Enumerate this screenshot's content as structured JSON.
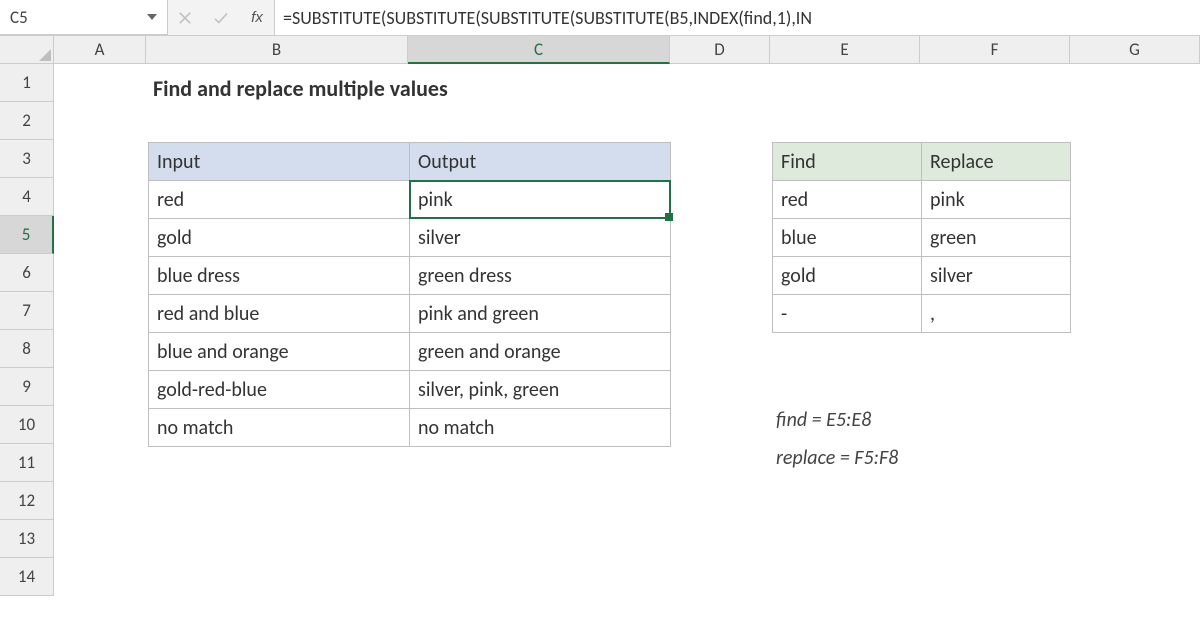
{
  "nameBox": "C5",
  "formula": "=SUBSTITUTE(SUBSTITUTE(SUBSTITUTE(SUBSTITUTE(B5,INDEX(find,1),IN",
  "columns": [
    "A",
    "B",
    "C",
    "D",
    "E",
    "F",
    "G"
  ],
  "rows": [
    "1",
    "2",
    "3",
    "4",
    "5",
    "6",
    "7",
    "8",
    "9",
    "10",
    "11",
    "12",
    "13",
    "14"
  ],
  "selectedCol": "C",
  "selectedRow": "5",
  "title": "Find and replace multiple values",
  "tableLeft": {
    "headers": [
      "Input",
      "Output"
    ],
    "rows": [
      [
        "red",
        "pink"
      ],
      [
        "gold",
        "silver"
      ],
      [
        "blue dress",
        "green dress"
      ],
      [
        "red and blue",
        "pink and green"
      ],
      [
        "blue and orange",
        "green and orange"
      ],
      [
        "gold-red-blue",
        "silver, pink, green"
      ],
      [
        "no match",
        "no match"
      ]
    ]
  },
  "tableRight": {
    "headers": [
      "Find",
      "Replace"
    ],
    "rows": [
      [
        "red",
        "pink"
      ],
      [
        "blue",
        "green"
      ],
      [
        "gold",
        "silver"
      ],
      [
        "-",
        ","
      ]
    ]
  },
  "notes": {
    "line1": "find = E5:E8",
    "line2": "replace = F5:F8"
  }
}
